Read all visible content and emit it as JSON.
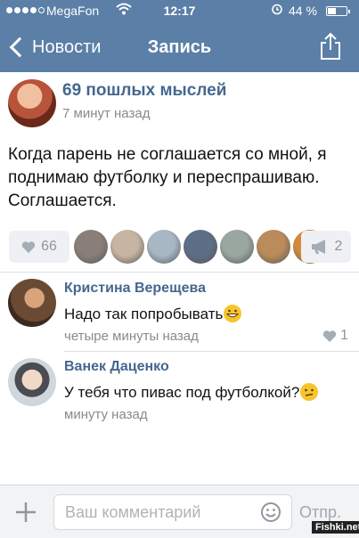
{
  "status_bar": {
    "carrier": "MegaFon",
    "time": "12:17",
    "battery": "44 %",
    "battery_level": 0.44
  },
  "nav": {
    "back_label": "Новости",
    "title": "Запись"
  },
  "post": {
    "author": "69 пошлых мыслей",
    "time": "7 минут назад",
    "text": "Когда парень не соглашается со мной, я поднимаю футболку и переспрашиваю. Соглашается.",
    "likes": "66",
    "reposts": "2",
    "liker_colors": [
      "#8a7f78",
      "#c7b5a2",
      "#a8b7c4",
      "#5d6f86",
      "#9aa7a0",
      "#b98c5a",
      "#d58a3a"
    ]
  },
  "comments": [
    {
      "author": "Кристина Верещева",
      "text": "Надо так попробывать",
      "emoji": "grinning-emoji",
      "time": "четыре минуты назад",
      "likes": "1"
    },
    {
      "author": "Ванек Даценко",
      "text": "У тебя что пивас под футболкой?",
      "emoji": "confused-emoji",
      "time": "минуту назад"
    }
  ],
  "composer": {
    "placeholder": "Ваш комментарий",
    "send_label": "Отпр."
  },
  "watermark": "Fishki.net",
  "colors": {
    "header": "#5b7fa7",
    "link": "#45678f",
    "muted": "#8a8a8a"
  }
}
